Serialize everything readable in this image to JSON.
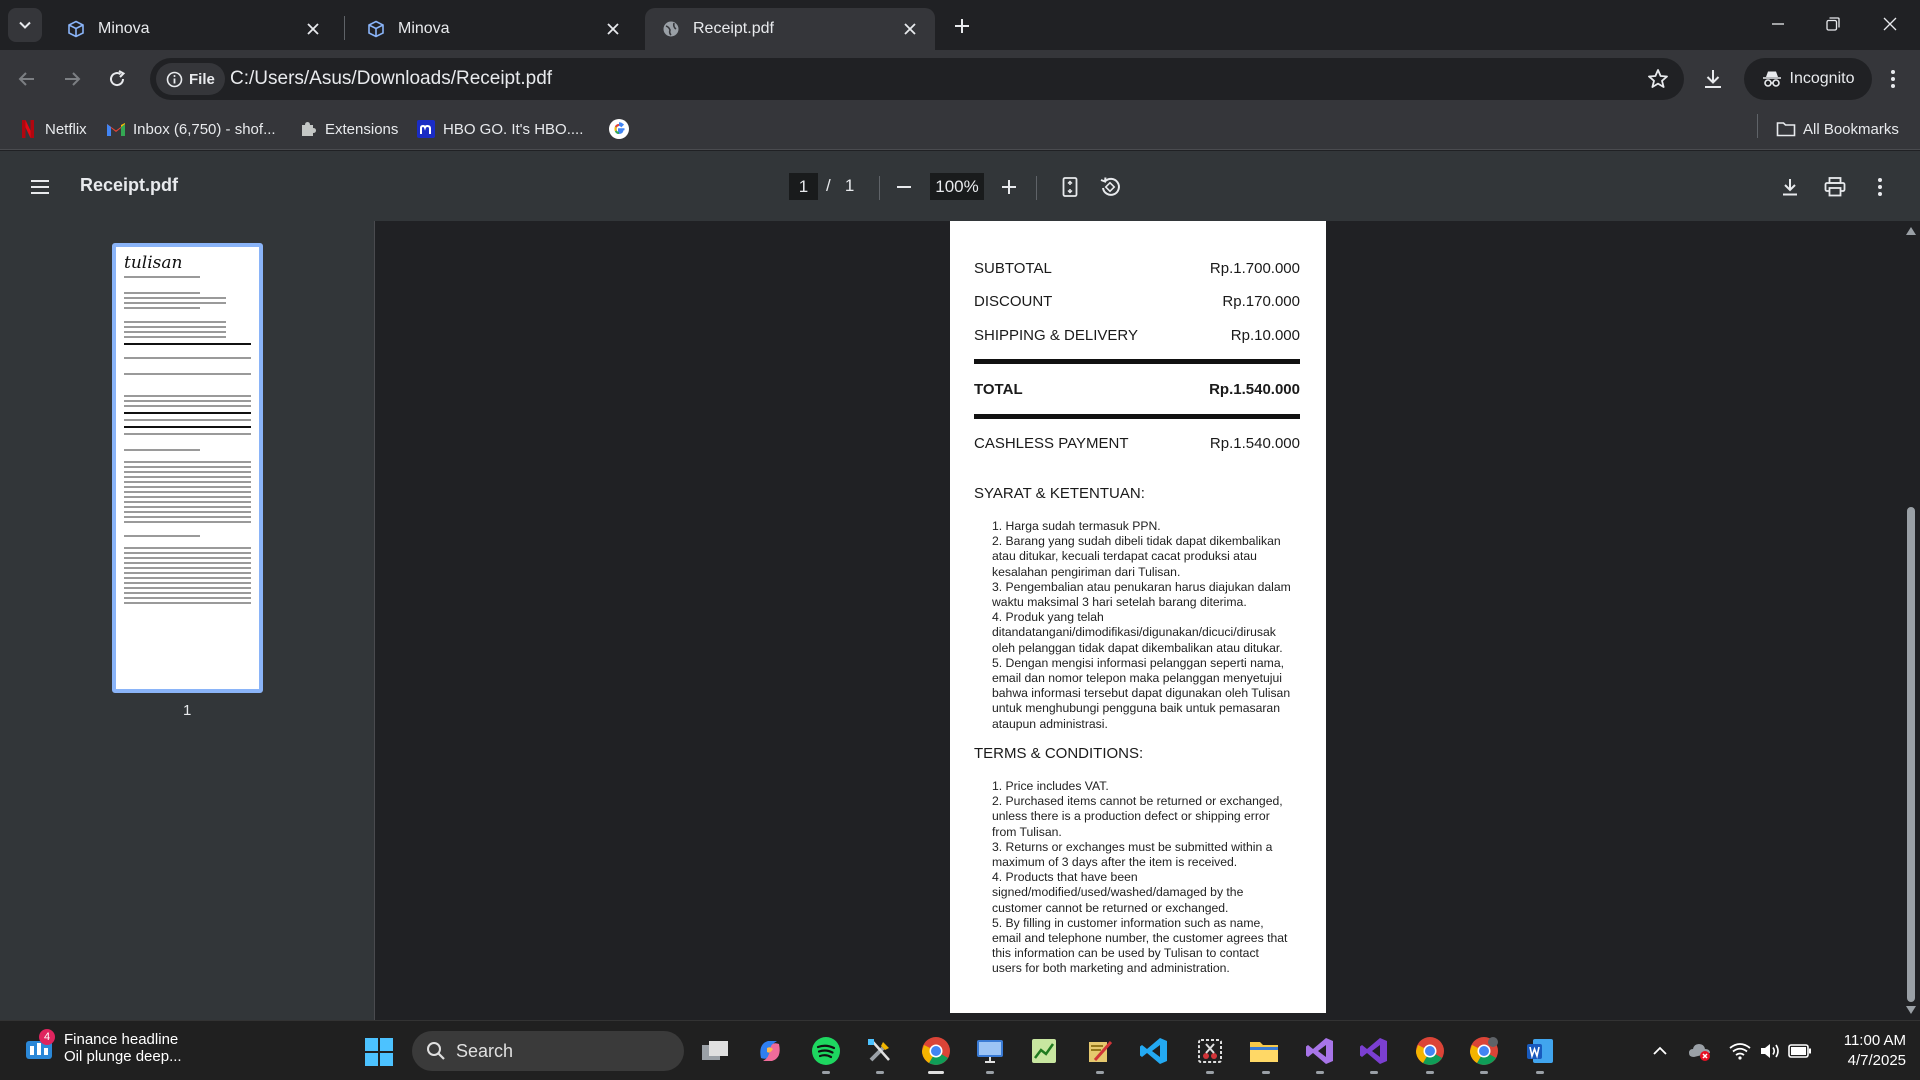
{
  "tabs": [
    {
      "title": "Minova",
      "icon": "cube-icon"
    },
    {
      "title": "Minova",
      "icon": "cube-icon"
    },
    {
      "title": "Receipt.pdf",
      "icon": "globe-icon",
      "active": true
    }
  ],
  "toolbar": {
    "site_chip": "File",
    "url": "C:/Users/Asus/Downloads/Receipt.pdf",
    "incognito_label": "Incognito"
  },
  "bookmarks": [
    {
      "label": "Netflix",
      "icon": "netflix-icon"
    },
    {
      "label": "Inbox (6,750) - shof...",
      "icon": "gmail-icon"
    },
    {
      "label": "Extensions",
      "icon": "puzzle-icon"
    },
    {
      "label": "HBO GO. It's HBO....",
      "icon": "hbo-icon"
    },
    {
      "label": "",
      "icon": "google-icon"
    }
  ],
  "all_bookmarks": "All Bookmarks",
  "pdf_viewer": {
    "title": "Receipt.pdf",
    "current_page": "1",
    "page_separator": "/",
    "total_pages": "1",
    "zoom": "100%",
    "thumbnail_label": "1",
    "thumbnail_logo": "tulisan"
  },
  "receipt": {
    "subtotal_label": "SUBTOTAL",
    "subtotal_value": "Rp.1.700.000",
    "discount_label": "DISCOUNT",
    "discount_value": "Rp.170.000",
    "shipping_label": "SHIPPING & DELIVERY",
    "shipping_value": "Rp.10.000",
    "total_label": "TOTAL",
    "total_value": "Rp.1.540.000",
    "cashless_label": "CASHLESS PAYMENT",
    "cashless_value": "Rp.1.540.000",
    "syarat_heading": "SYARAT & KETENTUAN:",
    "syarat_lines": [
      "1. Harga sudah termasuk PPN.",
      "2. Barang yang sudah dibeli tidak dapat dikembalikan",
      "atau ditukar, kecuali terdapat cacat produksi atau",
      "kesalahan pengiriman dari Tulisan.",
      "3. Pengembalian atau penukaran harus diajukan dalam",
      "waktu maksimal 3 hari setelah barang diterima.",
      "4. Produk yang telah",
      "ditandatangani/dimodifikasi/digunakan/dicuci/dirusak",
      "oleh pelanggan tidak dapat dikembalikan atau ditukar.",
      "5. Dengan mengisi informasi pelanggan seperti nama,",
      "email dan nomor telepon maka pelanggan menyetujui",
      "bahwa informasi tersebut dapat digunakan oleh Tulisan",
      "untuk menghubungi pengguna baik untuk pemasaran",
      "ataupun administrasi."
    ],
    "terms_heading": "TERMS & CONDITIONS:",
    "terms_lines": [
      "1. Price includes VAT.",
      "2. Purchased items cannot be returned or exchanged,",
      "unless there is a production defect or shipping error",
      "from Tulisan.",
      "3. Returns or exchanges must be submitted within a",
      "maximum of 3 days after the item is received.",
      "4. Products that have been",
      "signed/modified/used/washed/damaged by the",
      "customer cannot be returned or exchanged.",
      "5. By filling in customer information such as name,",
      "email and telephone number, the customer agrees that",
      "this information can be used by Tulisan to contact",
      "users for both marketing and administration."
    ]
  },
  "taskbar": {
    "widget_badge": "4",
    "widget_title": "Finance headline",
    "widget_subtitle": "Oil plunge deep...",
    "search_label": "Search",
    "apps": [
      "task-view-icon",
      "copilot-icon",
      "spotify-icon",
      "tools-icon",
      "chrome-icon",
      "remote-desktop-icon",
      "chart-app-icon",
      "pen-tool-icon",
      "vscode-icon",
      "snipping-icon",
      "file-explorer-icon",
      "visual-studio-icon",
      "visual-studio-alt-icon",
      "chrome-icon",
      "chrome-profile-icon",
      "word-icon"
    ],
    "time": "11:00 AM",
    "date": "4/7/2025"
  },
  "colors": {
    "accent": "#8ab4f8",
    "frame": "#202124",
    "toolbar": "#35363a",
    "pdf_toolbar": "#323639"
  }
}
